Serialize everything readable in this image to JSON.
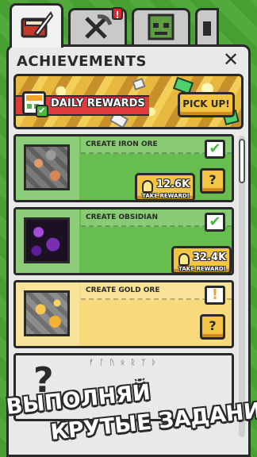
{
  "tabs": [
    {
      "name": "achievements",
      "icon": "book-feather-icon",
      "alert": ""
    },
    {
      "name": "tools",
      "icon": "crossed-pickaxe-icon",
      "alert": "!"
    },
    {
      "name": "monsters",
      "icon": "zombie-icon",
      "alert": ""
    },
    {
      "name": "more",
      "icon": "tab-letter-icon",
      "alert": ""
    }
  ],
  "panel": {
    "title": "ACHIEVEMENTS",
    "close": "✕"
  },
  "daily": {
    "label": "DAILY REWARDS",
    "button": "PICK UP!"
  },
  "achievements": [
    {
      "title": "CREATE IRON ORE",
      "state": "done",
      "ore": "iron",
      "amount": "12.6K",
      "sub": "TAKE REWARD!",
      "status": "✔",
      "hint": "?"
    },
    {
      "title": "CREATE OBSIDIAN",
      "state": "done",
      "ore": "obsidian",
      "amount": "32.4K",
      "sub": "TAKE REWARD!",
      "status": "✔"
    },
    {
      "title": "CREATE GOLD ORE",
      "state": "pending",
      "ore": "gold",
      "status": "!",
      "hint": "?"
    },
    {
      "title": "",
      "state": "locked",
      "cipher": "ᚠ ᛚ ᚢ ᛟ ᚱ ᛉ ᚦ",
      "lock": "?"
    }
  ],
  "promo": {
    "line1": "ВЫПОЛНЯЙ",
    "line2": "КРУТЫЕ ЗАДАНИЯ"
  },
  "colors": {
    "bg_green": "#4aa834",
    "done_card": "#67bd4d",
    "pending_card": "#f6da7c",
    "button_yellow": "#f4c542",
    "ribbon_red": "#e03a3a"
  }
}
